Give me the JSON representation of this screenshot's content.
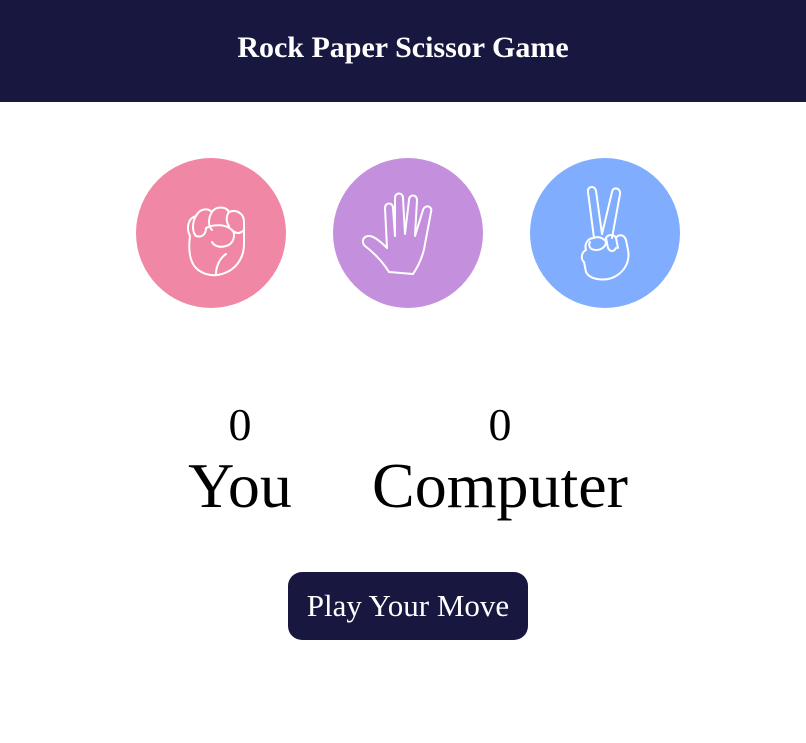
{
  "header": {
    "title": "Rock Paper Scissor Game",
    "background": "#181740"
  },
  "choices": [
    {
      "id": "rock",
      "icon": "fist-icon",
      "color": "#f087a4"
    },
    {
      "id": "paper",
      "icon": "open-hand-icon",
      "color": "#c490de"
    },
    {
      "id": "scissor",
      "icon": "peace-hand-icon",
      "color": "#80adfd"
    }
  ],
  "scoreboard": {
    "user": {
      "score": "0",
      "label": "You"
    },
    "computer": {
      "score": "0",
      "label": "Computer"
    }
  },
  "play_button": {
    "label": "Play Your Move",
    "background": "#181740"
  }
}
